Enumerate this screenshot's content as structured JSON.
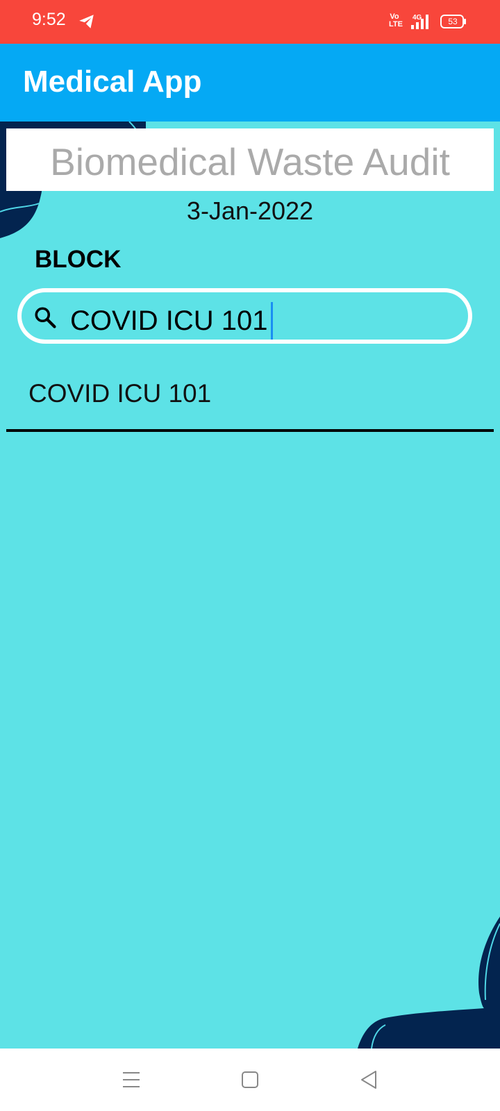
{
  "status_bar": {
    "time": "9:52",
    "network_label": "Vo LTE",
    "signal_label": "4G",
    "battery_level": "53",
    "icons": [
      "telegram-icon",
      "volte-icon",
      "signal-icon",
      "battery-icon"
    ],
    "color": "#f8463b"
  },
  "app_bar": {
    "title": "Medical App",
    "color": "#05a9f4"
  },
  "page": {
    "title": "Biomedical Waste Audit",
    "date": "3-Jan-2022",
    "field_label": "BLOCK",
    "background": "#5de2e6"
  },
  "search": {
    "value": "COVID ICU 101",
    "icon": "search-icon"
  },
  "results": [
    {
      "label": "COVID ICU 101"
    }
  ],
  "nav_bar": {
    "buttons": [
      "menu-icon",
      "home-icon",
      "back-icon"
    ]
  }
}
